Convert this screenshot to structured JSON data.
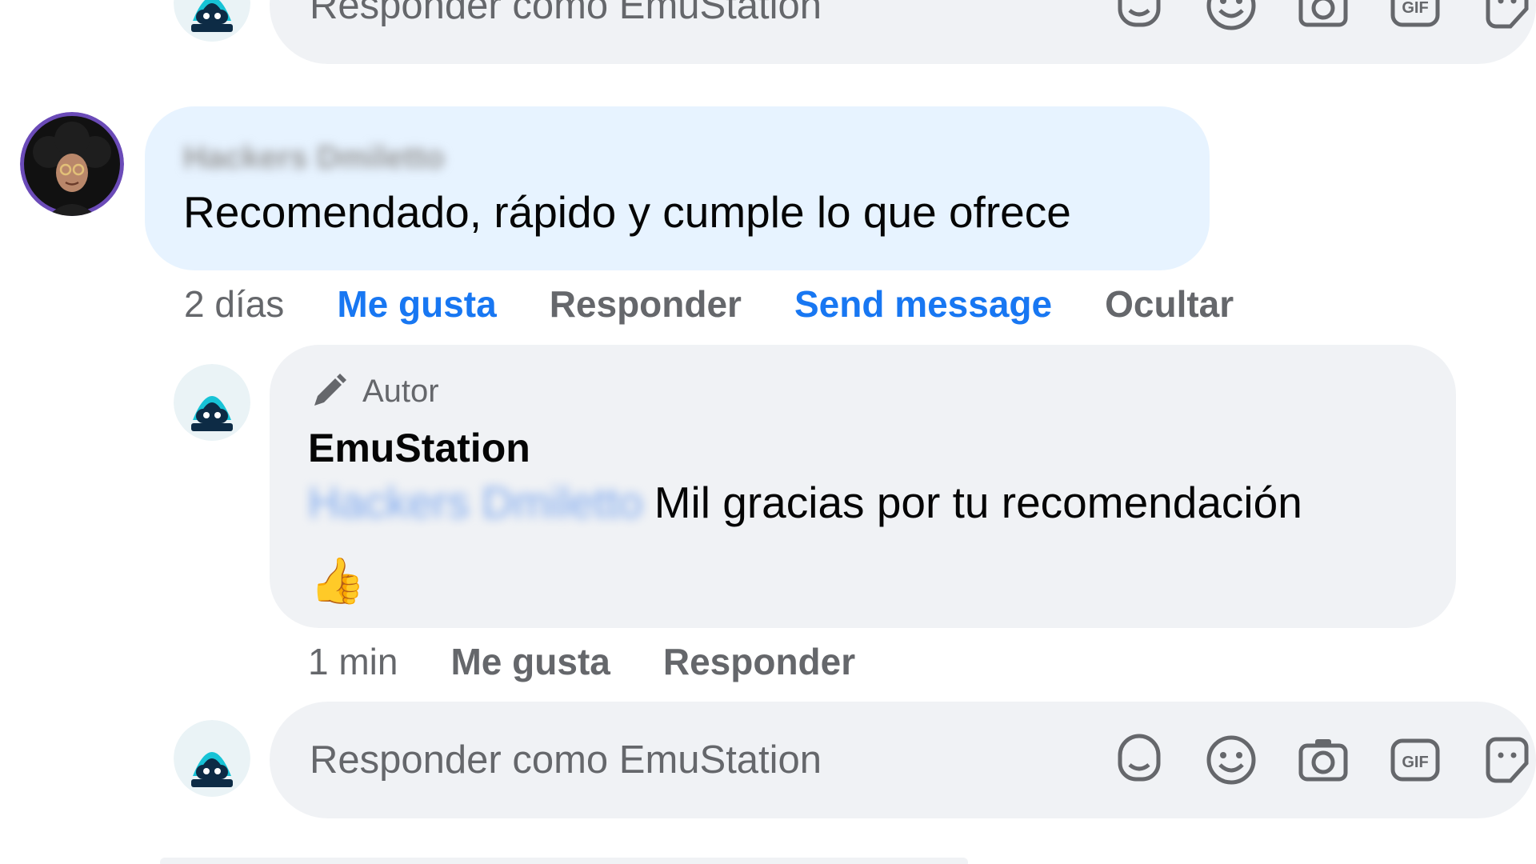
{
  "top_reply_bar": {
    "placeholder": "Responder como EmuStation",
    "icons": [
      "avatar-sticker-icon",
      "emoji-icon",
      "camera-icon",
      "gif-icon",
      "sticker-icon"
    ]
  },
  "comment": {
    "author_name_blurred": "Hackers Dmiletto",
    "text": "Recomendado, rápido y cumple lo que ofrece",
    "actions": {
      "time": "2 días",
      "like": "Me gusta",
      "reply": "Responder",
      "send_message": "Send message",
      "hide": "Ocultar"
    }
  },
  "reply": {
    "badge": "Autor",
    "author": "EmuStation",
    "mention_blurred": "Hackers Dmiletto",
    "text": "Mil gracias por tu recomendación",
    "emoji": "👍",
    "actions": {
      "time": "1 min",
      "like": "Me gusta",
      "reply": "Responder"
    }
  },
  "bottom_reply_bar": {
    "placeholder": "Responder como EmuStation"
  },
  "colors": {
    "link_blue": "#1877f2",
    "muted_text": "#65676b",
    "bubble_gray": "#f0f2f5",
    "bubble_blue": "#e7f3ff"
  }
}
